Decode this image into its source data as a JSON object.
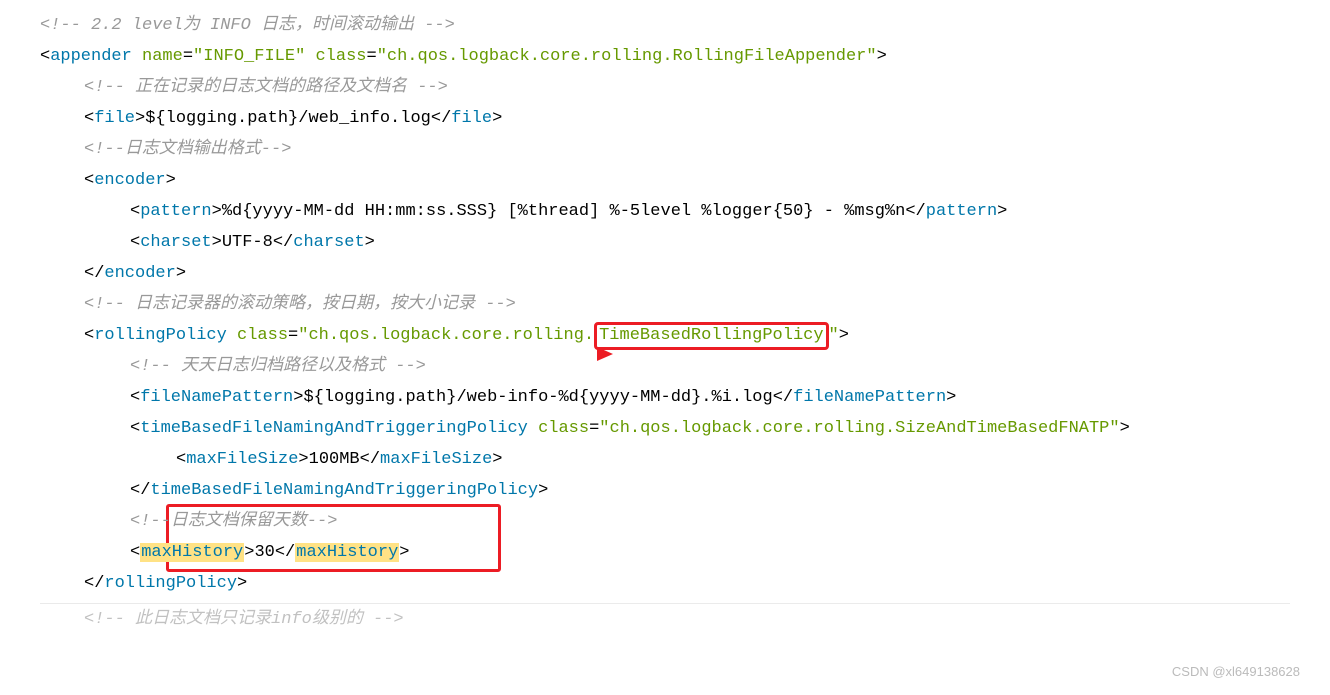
{
  "lines": {
    "c1": "<!-- 2.2 level为 INFO 日志，时间滚动输出  -->",
    "appender_open_1": "<",
    "appender_tag": "appender",
    "appender_name_attr": "name",
    "appender_name_val": "\"INFO_FILE\"",
    "appender_class_attr": "class",
    "appender_class_val": "\"ch.qos.logback.core.rolling.RollingFileAppender\"",
    "appender_close_1": ">",
    "c2": "<!-- 正在记录的日志文档的路径及文档名 -->",
    "file_tag": "file",
    "file_text": "${logging.path}/web_info.log",
    "c3": "<!--日志文档输出格式-->",
    "encoder_tag": "encoder",
    "pattern_tag": "pattern",
    "pattern_text": "%d{yyyy-MM-dd HH:mm:ss.SSS} [%thread] %-5level %logger{50} - %msg%n",
    "charset_tag": "charset",
    "charset_text": "UTF-8",
    "c4": "<!-- 日志记录器的滚动策略，按日期，按大小记录 -->",
    "rolling_tag": "rollingPolicy",
    "rolling_class_attr": "class",
    "rolling_class_val_pre": "\"ch.qos.logback.core.rolling.",
    "rolling_class_val_box": "TimeBasedRollingPolicy",
    "rolling_class_val_post": "\"",
    "c5": "<!-- 天天日志归档路径以及格式 -->",
    "fnp_tag": "fileNamePattern",
    "fnp_text": "${logging.path}/web-info-%d{yyyy-MM-dd}.%i.log",
    "tbf_tag": "timeBasedFileNamingAndTriggeringPolicy",
    "tbf_class_attr": "class",
    "tbf_class_val": "\"ch.qos.logback.core.rolling.SizeAndTimeBasedFNATP\"",
    "mfs_tag": "maxFileSize",
    "mfs_text": "100MB",
    "c6": "<!--日志文档保留天数-->",
    "mh_tag": "maxHistory",
    "mh_text": "30",
    "c7": "<!-- 此日志文档只记录info级别的 -->"
  },
  "watermark": "CSDN @xl649138628"
}
